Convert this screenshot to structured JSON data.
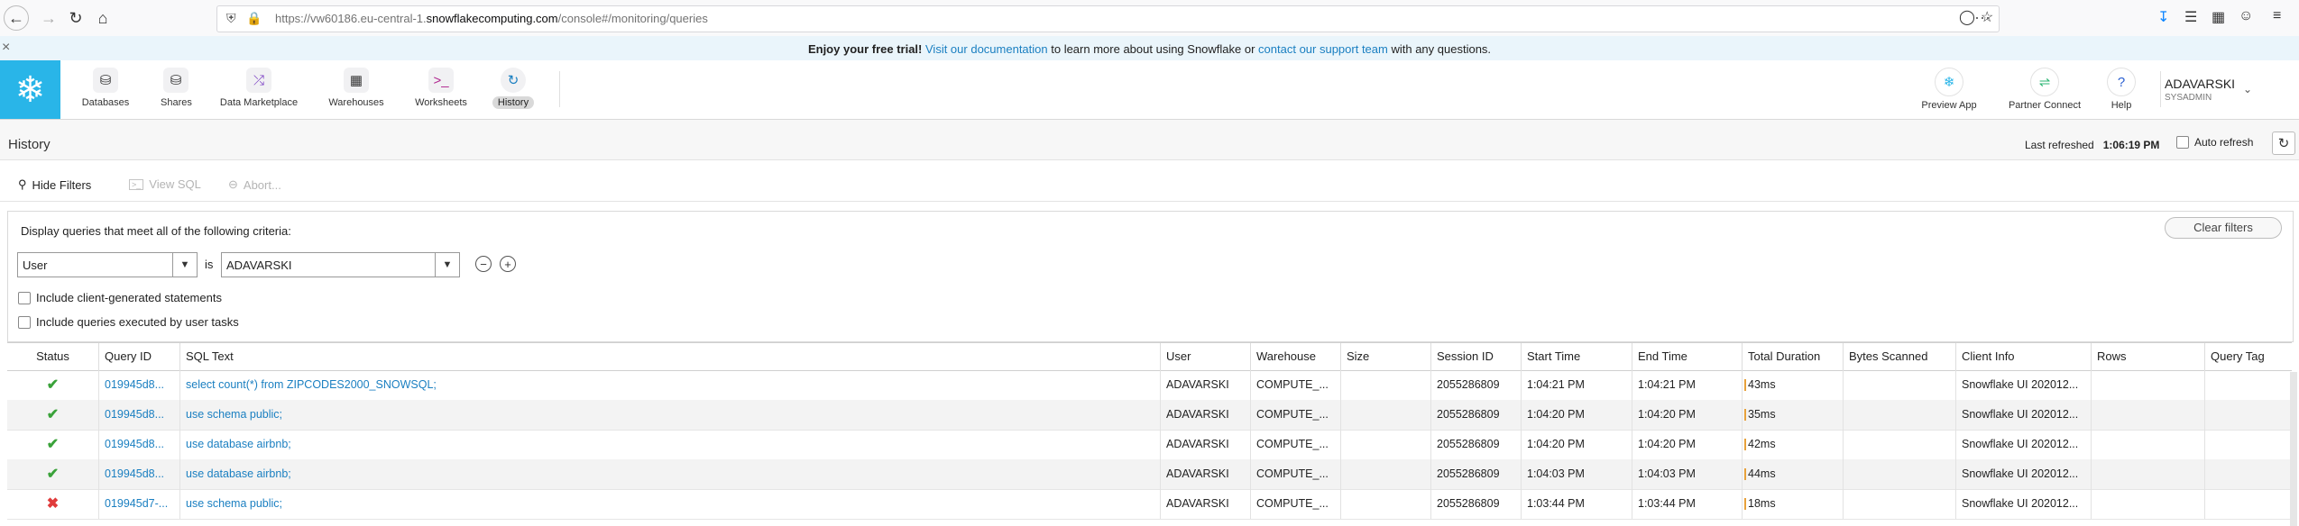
{
  "browser": {
    "url_prefix": "https://vw60186.eu-central-1.",
    "url_domain": "snowflakecomputing.com",
    "url_path": "/console#/monitoring/queries",
    "more_icon": "···"
  },
  "banner": {
    "lead": "Enjoy your free trial!",
    "link1": "Visit our documentation",
    "mid": " to learn more about using Snowflake or ",
    "link2": "contact our support team",
    "tail": " with any questions."
  },
  "nav": {
    "items": [
      {
        "label": "Databases",
        "icon": "database-icon"
      },
      {
        "label": "Shares",
        "icon": "shares-icon"
      },
      {
        "label": "Data Marketplace",
        "icon": "marketplace-icon"
      },
      {
        "label": "Warehouses",
        "icon": "warehouses-icon"
      },
      {
        "label": "Worksheets",
        "icon": "worksheets-icon"
      },
      {
        "label": "History",
        "icon": "history-icon"
      }
    ],
    "right": [
      {
        "label": "Preview App",
        "icon": "preview-app-icon"
      },
      {
        "label": "Partner Connect",
        "icon": "partner-connect-icon"
      },
      {
        "label": "Help",
        "icon": "help-icon"
      }
    ],
    "user": {
      "name": "ADAVARSKI",
      "role": "SYSADMIN"
    }
  },
  "page": {
    "title": "History",
    "last_refreshed_label": "Last refreshed",
    "last_refreshed_time": "1:06:19 PM",
    "auto_refresh_label": "Auto refresh"
  },
  "toolbar": {
    "hide_filters": "Hide Filters",
    "view_sql": "View SQL",
    "abort": "Abort..."
  },
  "filters": {
    "criteria_label": "Display queries that meet all of the following criteria:",
    "clear_label": "Clear filters",
    "field": "User",
    "operator": "is",
    "value": "ADAVARSKI",
    "check1": "Include client-generated statements",
    "check2": "Include queries executed by user tasks"
  },
  "table": {
    "headers": [
      "Status",
      "Query ID",
      "SQL Text",
      "User",
      "Warehouse",
      "Size",
      "Session ID",
      "Start Time",
      "End Time",
      "Total Duration",
      "Bytes Scanned",
      "Client Info",
      "Rows",
      "Query Tag"
    ],
    "rows": [
      {
        "status": "success",
        "query_id": "019945d8...",
        "sql": "select count(*) from ZIPCODES2000_SNOWSQL;",
        "user": "ADAVARSKI",
        "warehouse": "COMPUTE_...",
        "size": "",
        "session": "2055286809",
        "start": "1:04:21 PM",
        "end": "1:04:21 PM",
        "duration": "43ms",
        "bytes": "",
        "client": "Snowflake UI 202012...",
        "rows": "",
        "tag": ""
      },
      {
        "status": "success",
        "query_id": "019945d8...",
        "sql": "use schema public;",
        "user": "ADAVARSKI",
        "warehouse": "COMPUTE_...",
        "size": "",
        "session": "2055286809",
        "start": "1:04:20 PM",
        "end": "1:04:20 PM",
        "duration": "35ms",
        "bytes": "",
        "client": "Snowflake UI 202012...",
        "rows": "",
        "tag": ""
      },
      {
        "status": "success",
        "query_id": "019945d8...",
        "sql": "use database airbnb;",
        "user": "ADAVARSKI",
        "warehouse": "COMPUTE_...",
        "size": "",
        "session": "2055286809",
        "start": "1:04:20 PM",
        "end": "1:04:20 PM",
        "duration": "42ms",
        "bytes": "",
        "client": "Snowflake UI 202012...",
        "rows": "",
        "tag": ""
      },
      {
        "status": "success",
        "query_id": "019945d8...",
        "sql": "use database airbnb;",
        "user": "ADAVARSKI",
        "warehouse": "COMPUTE_...",
        "size": "",
        "session": "2055286809",
        "start": "1:04:03 PM",
        "end": "1:04:03 PM",
        "duration": "44ms",
        "bytes": "",
        "client": "Snowflake UI 202012...",
        "rows": "",
        "tag": ""
      },
      {
        "status": "failed",
        "query_id": "019945d7-...",
        "sql": "use schema public;",
        "user": "ADAVARSKI",
        "warehouse": "COMPUTE_...",
        "size": "",
        "session": "2055286809",
        "start": "1:03:44 PM",
        "end": "1:03:44 PM",
        "duration": "18ms",
        "bytes": "",
        "client": "Snowflake UI 202012...",
        "rows": "",
        "tag": ""
      }
    ]
  }
}
